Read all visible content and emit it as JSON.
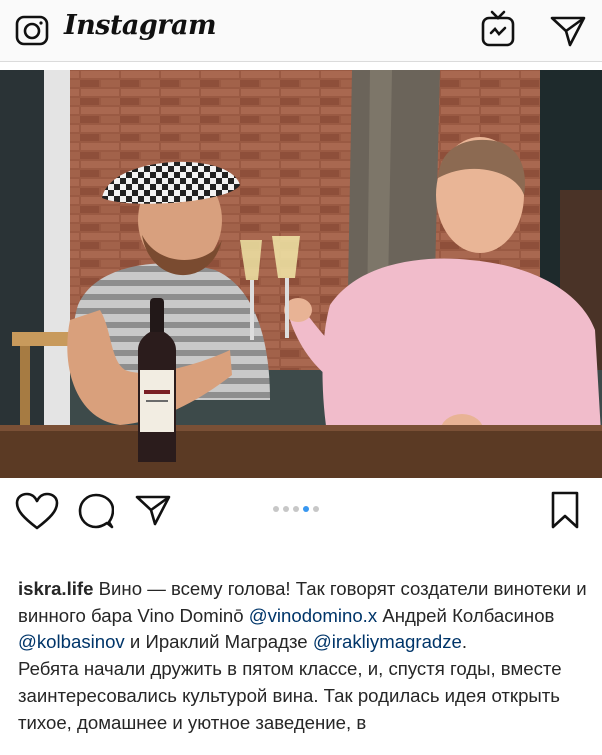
{
  "app": {
    "logo_text": "Instagram"
  },
  "icons": {
    "camera": "camera-icon",
    "igtv": "igtv-icon",
    "direct": "direct-message-icon",
    "like": "heart-icon",
    "comment": "comment-icon",
    "share": "share-icon",
    "save": "bookmark-icon"
  },
  "post": {
    "carousel": {
      "count": 5,
      "active_index": 3
    },
    "caption": {
      "username": "iskra.life",
      "text_1": " Вино — всему голова! Так говорят создатели винотеки и винного бара Vino Dominō ",
      "mention_1": "@vinodomino.x",
      "text_2": " Андрей Колбасинов ",
      "mention_2": "@kolbasinov",
      "text_3": " и Ираклий Маградзе ",
      "mention_3": "@irakliymagradze",
      "text_4": ".",
      "paragraph_2": "Ребята начали дружить в пятом классе, и, спустя годы, вместе заинтересовались культурой вина. Так родилась идея открыть тихое, домашнее и уютное заведение, в"
    }
  },
  "colors": {
    "accent": "#3897f0",
    "mention": "#003569",
    "text": "#262626"
  }
}
